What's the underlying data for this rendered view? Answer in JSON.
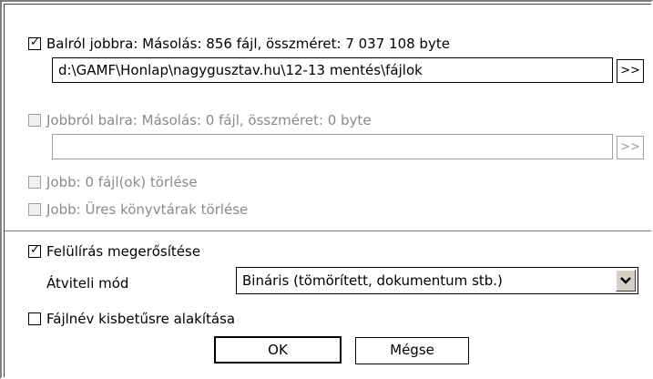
{
  "left_to_right": {
    "checked": true,
    "label": "Balról jobbra: Másolás: 856 fájl, összméret: 7 037 108 byte",
    "path": "d:\\GAMF\\Honlap\\nagygusztav.hu\\12-13 mentés\\fájlok",
    "browse_label": ">>"
  },
  "right_to_left": {
    "checked": false,
    "label": "Jobbról balra: Másolás: 0 fájl, összméret: 0 byte",
    "path": "",
    "browse_label": ">>"
  },
  "right_delete_files": {
    "checked": false,
    "label": "Jobb: 0 fájl(ok) törlése"
  },
  "right_delete_empty_dirs": {
    "checked": false,
    "label": "Jobb: Üres könyvtárak törlése"
  },
  "confirm_overwrite": {
    "checked": true,
    "label": "Felülírás megerősítése"
  },
  "transfer_mode": {
    "label": "Átviteli mód",
    "selected": "Bináris (tömörített, dokumentum stb.)"
  },
  "lowercase_filenames": {
    "checked": false,
    "label": "Fájlnév kisbetűsre alakítása"
  },
  "buttons": {
    "ok": "OK",
    "cancel": "Mégse"
  }
}
